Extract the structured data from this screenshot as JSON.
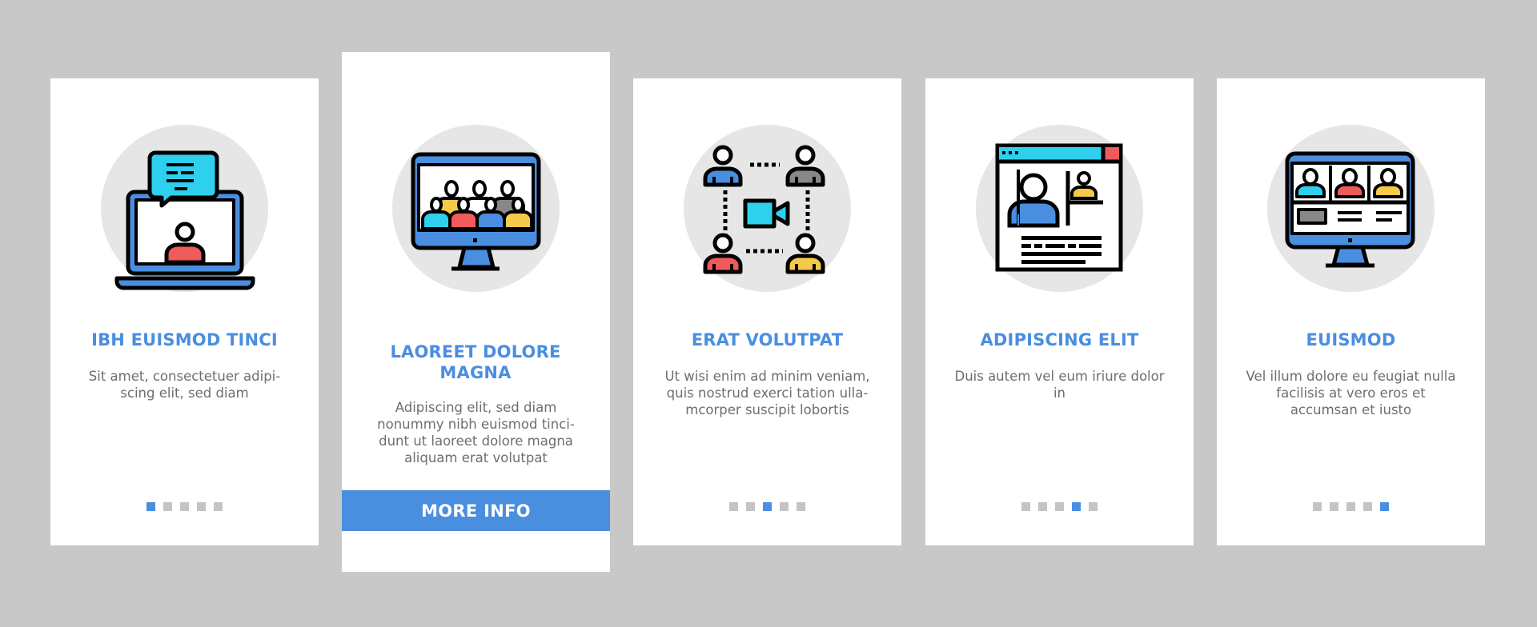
{
  "theme": {
    "background": "#c8c8c8",
    "card_background": "#ffffff",
    "accent": "#4a8ee0",
    "circle": "#e6e6e6",
    "text_gray": "#6e6e6e",
    "dot_inactive": "#c4c4c4"
  },
  "cards": [
    {
      "icon": "laptop-video-chat-icon",
      "title": "IBH EUISMOD TINCI",
      "body": "Sit amet, consectetuer adipi-\nscing elit, sed diam",
      "active_page": 1,
      "total_pages": 5
    },
    {
      "icon": "monitor-group-conference-icon",
      "title": "LAOREET DOLORE MAGNA",
      "body": "Adipiscing elit, sed diam nonummy nibh euismod tinci-\ndunt ut laoreet dolore magna aliquam erat volutpat",
      "button_label": "MORE INFO"
    },
    {
      "icon": "video-call-network-icon",
      "title": "ERAT VOLUTPAT",
      "body": "Ut wisi enim ad minim veniam, quis nostrud exerci tation ulla-\nmcorper suscipit lobortis",
      "active_page": 3,
      "total_pages": 5
    },
    {
      "icon": "browser-webinar-icon",
      "title": "ADIPISCING ELIT",
      "body": "Duis autem vel eum iriure dolor in",
      "active_page": 4,
      "total_pages": 5
    },
    {
      "icon": "monitor-three-participants-icon",
      "title": "EUISMOD",
      "body": "Vel illum dolore eu feugiat nulla facilisis at vero eros et accumsan et iusto",
      "active_page": 5,
      "total_pages": 5
    }
  ]
}
